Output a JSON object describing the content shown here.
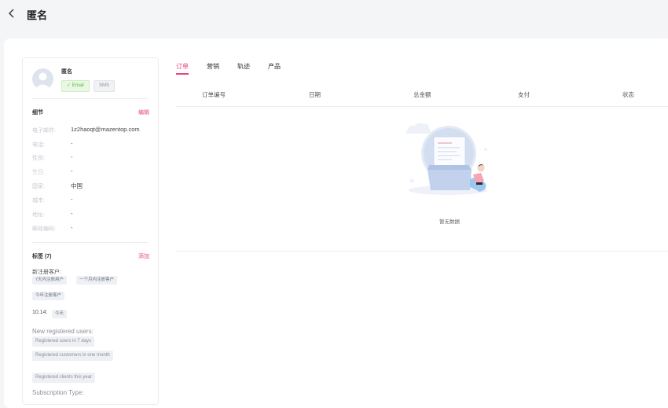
{
  "header": {
    "title": "匿名",
    "back_icon": "chevron-left-icon"
  },
  "customer": {
    "name": "匿名",
    "channels": [
      "✓ Email",
      "SMS"
    ]
  },
  "details": {
    "title": "细节",
    "edit_label": "编辑",
    "fields": [
      {
        "label": "电子邮件:",
        "value": "1z2haoqt@mazentop.com"
      },
      {
        "label": "电话:",
        "value": "-"
      },
      {
        "label": "性别:",
        "value": "-"
      },
      {
        "label": "生日:",
        "value": "-"
      },
      {
        "label": "国家:",
        "value": "中国"
      },
      {
        "label": "城市:",
        "value": "-"
      },
      {
        "label": "地址:",
        "value": "-"
      },
      {
        "label": "邮政编码:",
        "value": "-"
      }
    ]
  },
  "tags": {
    "title": "标签 (7)",
    "add_label": "添加",
    "groups": [
      {
        "title": "新注册客户:",
        "items": [
          "7天内注册用户",
          "一个月内注册客户",
          "今年注册客户"
        ]
      },
      {
        "title": "10.14:",
        "items": [
          "今天"
        ]
      },
      {
        "title": "New registered users:",
        "items": [
          "Registered users in 7 days",
          "Registered customers in one month",
          "Registered clients this year"
        ]
      }
    ],
    "partial_next_group": "Subscription Type:"
  },
  "tabs": [
    "订单",
    "营销",
    "轨迹",
    "产品"
  ],
  "active_tab": 0,
  "table": {
    "columns": [
      "订单编号",
      "日期",
      "总金额",
      "支付",
      "状态"
    ],
    "empty_text": "暂无数据"
  },
  "colors": {
    "accent": "#e8457a",
    "email_green": "#5cb83c"
  }
}
